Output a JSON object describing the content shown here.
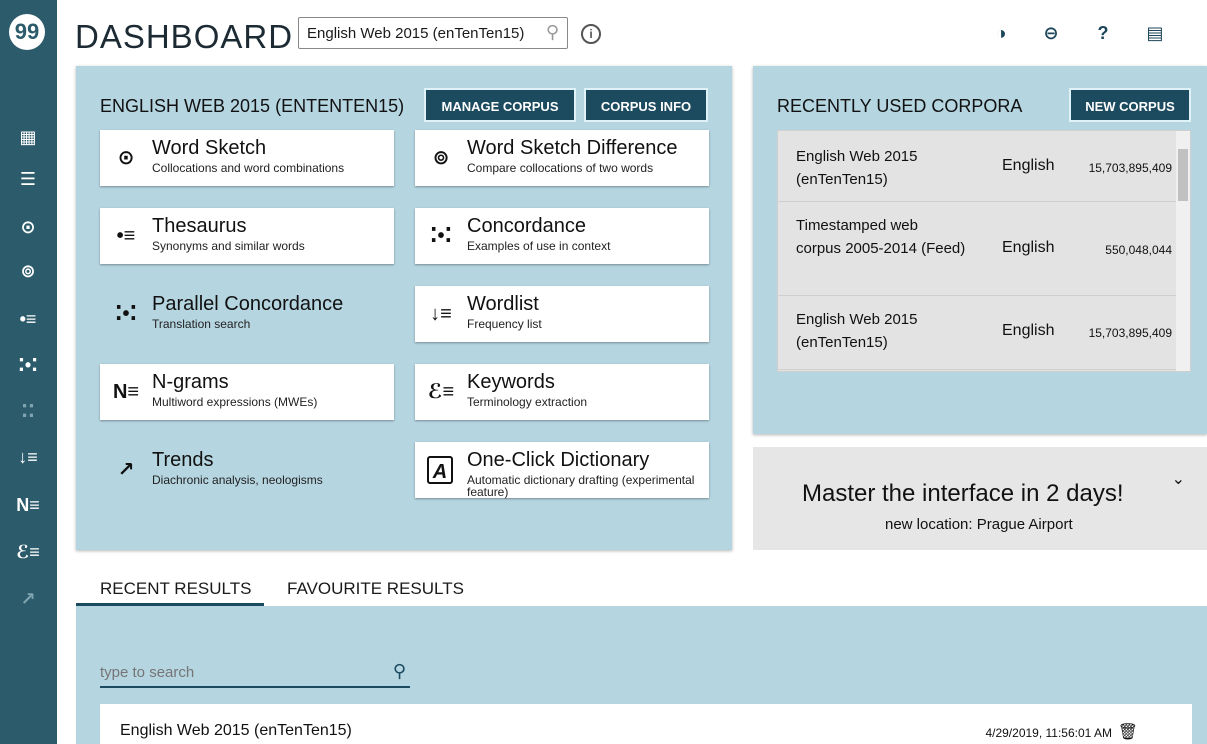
{
  "app": {
    "title": "DASHBOARD",
    "logo_text": "99"
  },
  "header": {
    "corpus_select_value": "English Web 2015 (enTenTen15)",
    "icons": [
      "theme-icon",
      "link-icon",
      "help-icon",
      "feedback-icon"
    ]
  },
  "sidebar": {
    "items": [
      {
        "name": "dashboard-icon",
        "glyph": "▦"
      },
      {
        "name": "corpus-list-icon",
        "glyph": "☰"
      },
      {
        "name": "word-sketch-icon",
        "glyph": "⊙"
      },
      {
        "name": "sketch-diff-icon",
        "glyph": "⊚"
      },
      {
        "name": "thesaurus-icon",
        "glyph": "•≡"
      },
      {
        "name": "concordance-icon",
        "glyph": "⁚•⁚"
      },
      {
        "name": "parallel-concordance-icon",
        "glyph": "⁚⁚"
      },
      {
        "name": "wordlist-icon",
        "glyph": "↓≡"
      },
      {
        "name": "ngrams-icon",
        "glyph": "N≡"
      },
      {
        "name": "keywords-icon",
        "glyph": "ℰ≡"
      },
      {
        "name": "trends-icon",
        "glyph": "↗"
      }
    ]
  },
  "corpus_panel": {
    "title": "ENGLISH WEB 2015 (ENTENTEN15)",
    "manage_label": "MANAGE CORPUS",
    "info_label": "CORPUS INFO",
    "tools": [
      {
        "name": "Word Sketch",
        "desc": "Collocations and word combinations",
        "glyph": "⊙"
      },
      {
        "name": "Word Sketch Difference",
        "desc": "Compare collocations of two words",
        "glyph": "⊚"
      },
      {
        "name": "Thesaurus",
        "desc": "Synonyms and similar words",
        "glyph": "•≡"
      },
      {
        "name": "Concordance",
        "desc": "Examples of use in context",
        "glyph": "⁚•⁚"
      },
      {
        "name": "Parallel Concordance",
        "desc": "Translation search",
        "glyph": "⁚•⁚"
      },
      {
        "name": "Wordlist",
        "desc": "Frequency list",
        "glyph": "↓≡"
      },
      {
        "name": "N-grams",
        "desc": "Multiword expressions (MWEs)",
        "glyph": "N≡"
      },
      {
        "name": "Keywords",
        "desc": "Terminology extraction",
        "glyph": "ℰ≡"
      },
      {
        "name": "Trends",
        "desc": "Diachronic analysis, neologisms",
        "glyph": "↗"
      },
      {
        "name": "One-Click Dictionary",
        "desc": "Automatic dictionary drafting (experimental feature)",
        "glyph": "A"
      }
    ]
  },
  "recent_corpora": {
    "title": "RECENTLY USED CORPORA",
    "new_label": "NEW CORPUS",
    "rows": [
      {
        "name": "English Web 2015 (enTenTen15)",
        "lang": "English",
        "size": "15,703,895,409"
      },
      {
        "name": "Timestamped web corpus 2005-2014 (Feed)",
        "lang": "English",
        "size": "550,048,044"
      },
      {
        "name": "English Web 2015 (enTenTen15)",
        "lang": "English",
        "size": "15,703,895,409"
      }
    ]
  },
  "promo": {
    "title": "Master the interface in 2 days!",
    "subtitle": "new location: Prague Airport"
  },
  "results": {
    "tabs": [
      "RECENT RESULTS",
      "FAVOURITE RESULTS"
    ],
    "search_placeholder": "type to search",
    "rows": [
      {
        "name": "English Web 2015 (enTenTen15)",
        "date": "4/29/2019, 11:56:01 AM"
      }
    ]
  }
}
